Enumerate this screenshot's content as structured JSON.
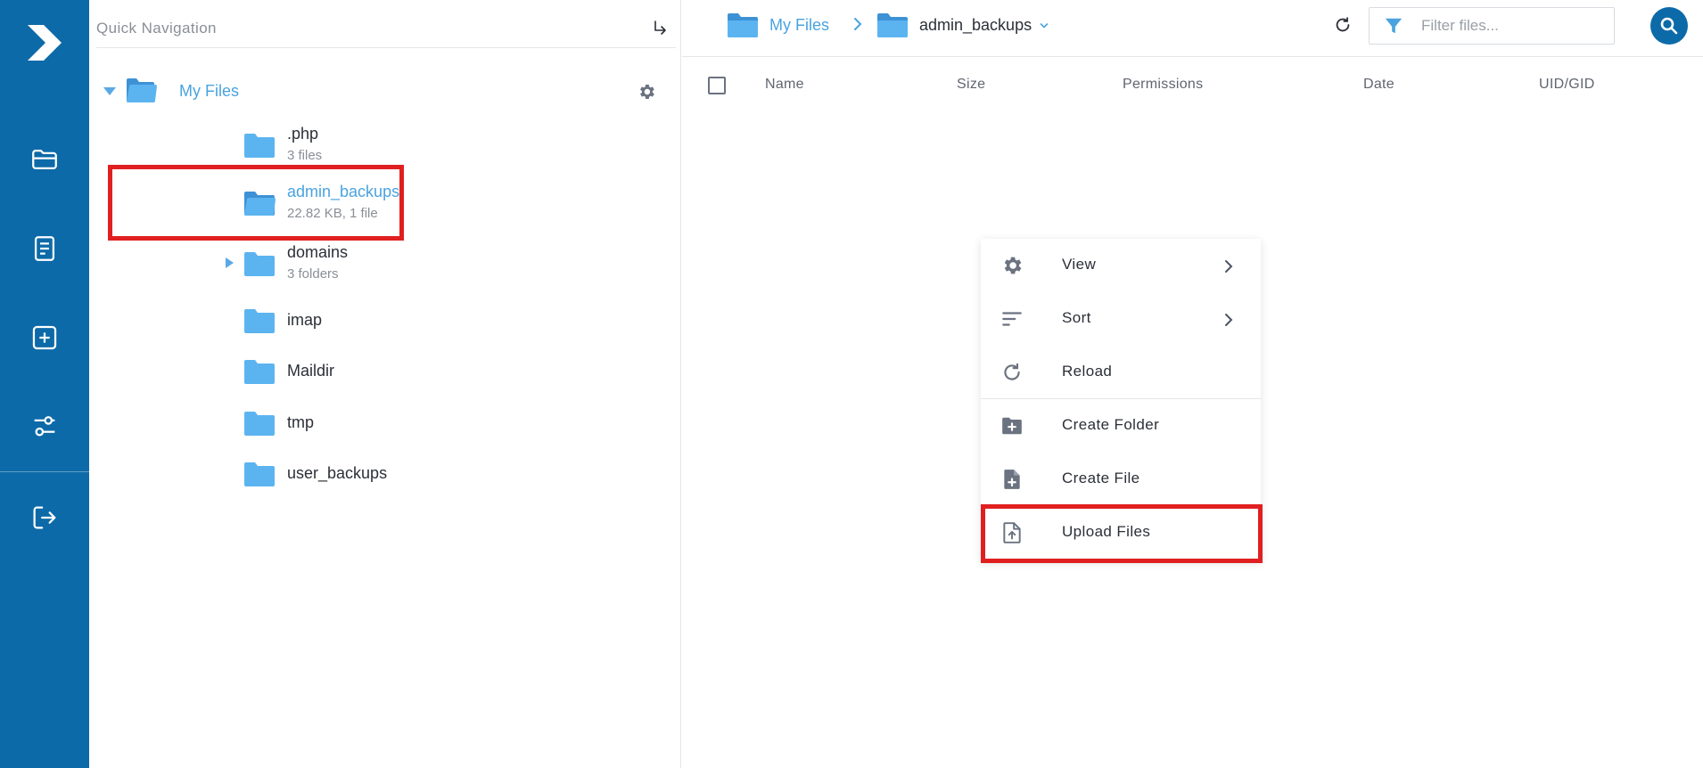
{
  "quick_nav": {
    "placeholder": "Quick Navigation"
  },
  "tree": {
    "root_label": "My Files",
    "items": [
      {
        "name": ".php",
        "meta": "3 files"
      },
      {
        "name": "admin_backups",
        "meta": "22.82 KB, 1 file"
      },
      {
        "name": "domains",
        "meta": "3 folders"
      },
      {
        "name": "imap",
        "meta": ""
      },
      {
        "name": "Maildir",
        "meta": ""
      },
      {
        "name": "tmp",
        "meta": ""
      },
      {
        "name": "user_backups",
        "meta": ""
      }
    ]
  },
  "breadcrumb": {
    "root": "My Files",
    "current": "admin_backups"
  },
  "filter": {
    "placeholder": "Filter files..."
  },
  "table": {
    "columns": [
      "Name",
      "Size",
      "Permissions",
      "Date",
      "UID/GID"
    ]
  },
  "context_menu": {
    "items": [
      {
        "label": "View",
        "icon": "gear-icon",
        "submenu": true
      },
      {
        "label": "Sort",
        "icon": "sort-icon",
        "submenu": true
      },
      {
        "label": "Reload",
        "icon": "reload-icon",
        "submenu": false
      },
      {
        "label": "Create Folder",
        "icon": "folder-plus-icon",
        "submenu": false
      },
      {
        "label": "Create File",
        "icon": "file-plus-icon",
        "submenu": false
      },
      {
        "label": "Upload Files",
        "icon": "file-upload-icon",
        "submenu": false
      }
    ]
  },
  "colors": {
    "sidebar": "#0d6aa8",
    "accent": "#4aa3df",
    "folder": "#5bb4f0",
    "highlight": "#e02020"
  }
}
